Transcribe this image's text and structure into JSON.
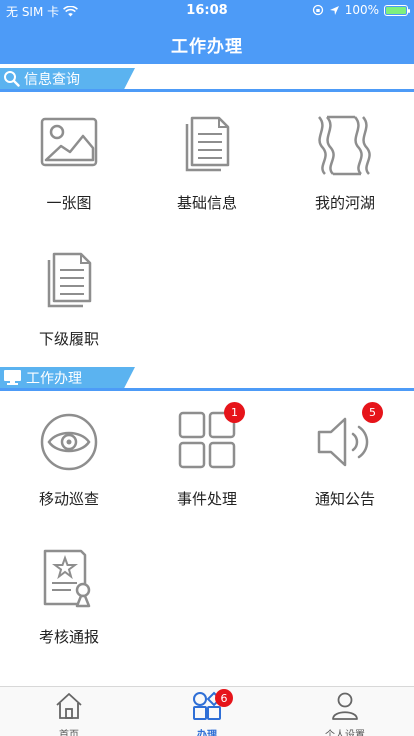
{
  "status": {
    "carrier": "无 SIM 卡",
    "time": "16:08",
    "battery": "100%"
  },
  "nav": {
    "title": "工作办理"
  },
  "sections": [
    {
      "title": "信息查询",
      "items": [
        {
          "label": "一张图",
          "icon": "picture-icon"
        },
        {
          "label": "基础信息",
          "icon": "document-stack-icon"
        },
        {
          "label": "我的河湖",
          "icon": "river-waves-icon"
        },
        {
          "label": "下级履职",
          "icon": "document-stack-icon"
        }
      ]
    },
    {
      "title": "工作办理",
      "items": [
        {
          "label": "移动巡查",
          "icon": "eye-icon"
        },
        {
          "label": "事件处理",
          "icon": "grid-squares-icon",
          "badge": "1"
        },
        {
          "label": "通知公告",
          "icon": "speaker-icon",
          "badge": "5"
        },
        {
          "label": "考核通报",
          "icon": "certificate-icon"
        }
      ]
    }
  ],
  "tabbar": {
    "items": [
      {
        "label": "首页",
        "icon": "home-icon"
      },
      {
        "label": "办理",
        "icon": "shapes-icon",
        "badge": "6",
        "active": true
      },
      {
        "label": "个人设置",
        "icon": "user-icon"
      }
    ]
  },
  "colors": {
    "primary": "#4d9bf7",
    "badge": "#e6141a",
    "ribbon": "#5bb3f0"
  }
}
